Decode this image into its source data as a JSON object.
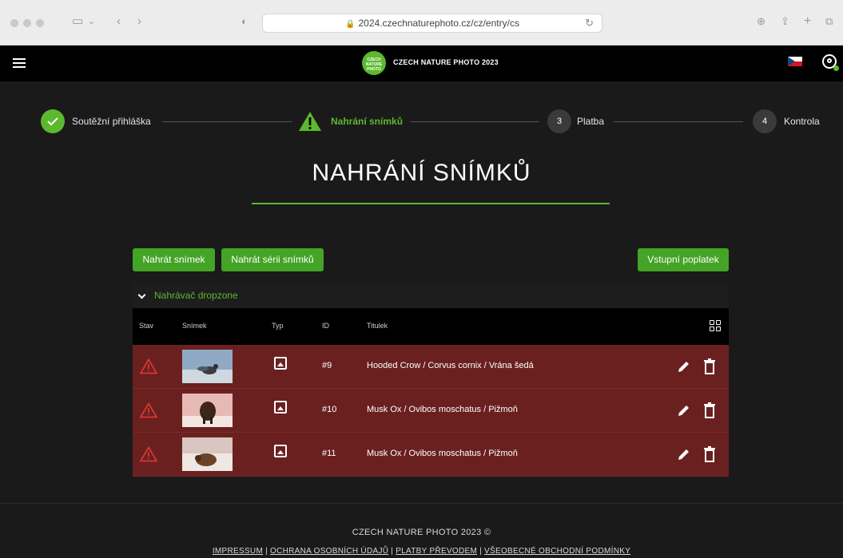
{
  "browser": {
    "url": "2024.czechnaturephoto.cz/cz/entry/cs"
  },
  "header": {
    "logo_badge_lines": [
      "CZECH",
      "NATURE",
      "PHOTO"
    ],
    "logo_text": "CZECH NATURE PHOTO 2023",
    "flag": "czech-flag"
  },
  "stepper": [
    {
      "number": "",
      "label": "Soutěžní přihláška",
      "state": "done"
    },
    {
      "number": "",
      "label": "Nahrání snímků",
      "state": "warning"
    },
    {
      "number": "3",
      "label": "Platba",
      "state": "pending"
    },
    {
      "number": "4",
      "label": "Kontrola",
      "state": "pending"
    }
  ],
  "page": {
    "title": "NAHRÁNÍ SNÍMKŮ"
  },
  "buttons": {
    "upload_single": "Nahrát snímek",
    "upload_series": "Nahrát sérii snímků",
    "entry_fee": "Vstupní poplatek"
  },
  "dropzone": {
    "label": "Nahrávač dropzone"
  },
  "table": {
    "columns": [
      "Stav",
      "Snímek",
      "Typ",
      "ID",
      "Titulek"
    ],
    "rows": [
      {
        "status": "warning",
        "type": "image-icon",
        "id": "#9",
        "title": "Hooded Crow / Corvus cornix / Vrána šedá"
      },
      {
        "status": "warning",
        "type": "image-icon",
        "id": "#10",
        "title": "Musk Ox / Ovibos moschatus / Pižmoň"
      },
      {
        "status": "warning",
        "type": "image-icon",
        "id": "#11",
        "title": "Musk Ox / Ovibos moschatus / Pižmoň"
      }
    ]
  },
  "footer": {
    "copyright": "CZECH NATURE PHOTO 2023 ©",
    "links": [
      "IMPRESSUM",
      "OCHRANA OSOBNÍCH ÚDAJŮ",
      "PLATBY PŘEVODEM",
      "VŠEOBECNÉ OBCHODNÍ PODMÍNKY"
    ]
  },
  "colors": {
    "accent_green": "#5cb82e",
    "button_green": "#43a425",
    "row_error": "#6b2020",
    "warning_red": "#e53935",
    "header_bg": "#000000",
    "page_bg": "#1a1a1a"
  }
}
